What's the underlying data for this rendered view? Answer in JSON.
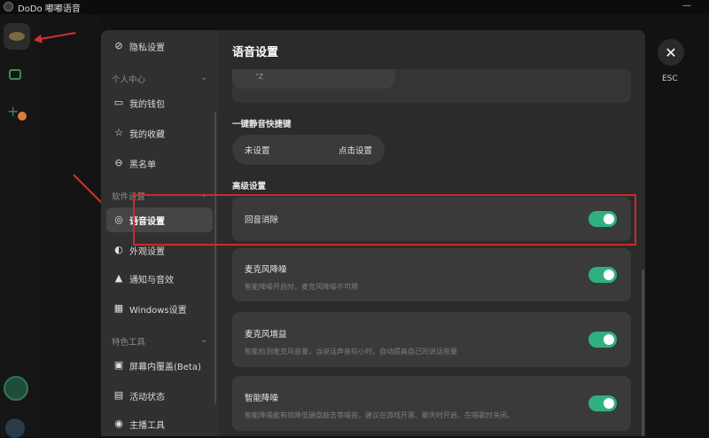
{
  "app": {
    "title": "DoDo 嘟嘟语音",
    "minimize": "—",
    "maximize": "□"
  },
  "nav": {
    "privacy": "隐私设置",
    "personal_center": "个人中心",
    "wallet": "我的钱包",
    "favorites": "我的收藏",
    "blacklist": "黑名单",
    "software_settings": "软件设置",
    "voice_settings": "语音设置",
    "appearance": "外观设置",
    "notifications": "通知与音效",
    "windows": "Windows设置",
    "features": "特色工具",
    "overlay": "屏幕内覆盖(Beta)",
    "activity": "活动状态",
    "streamer": "主播工具"
  },
  "content": {
    "title": "语音设置",
    "top_card_text": "\"Z",
    "hotkey_section": "一键静音快捷键",
    "hotkey_value": "未设置",
    "hotkey_action": "点击设置",
    "advanced_section": "高级设置",
    "options": [
      {
        "title": "回音消除",
        "desc": "",
        "enabled": true
      },
      {
        "title": "麦克风降噪",
        "desc": "智能降噪开启时，麦克风降噪不可用",
        "enabled": true
      },
      {
        "title": "麦克风增益",
        "desc": "智能检测麦克风音量，当说话声音较小时，自动提高自己的说话音量",
        "enabled": true
      },
      {
        "title": "智能降噪",
        "desc": "智能降噪能有效降低键盘敲击等噪音，建议在游戏开黑、聊天时开启，在唱歌时关闭。",
        "enabled": true
      }
    ]
  },
  "esc": {
    "close": "✕",
    "label": "ESC"
  },
  "colors": {
    "toggle_on": "#2fb07f",
    "highlight": "#d02828"
  }
}
